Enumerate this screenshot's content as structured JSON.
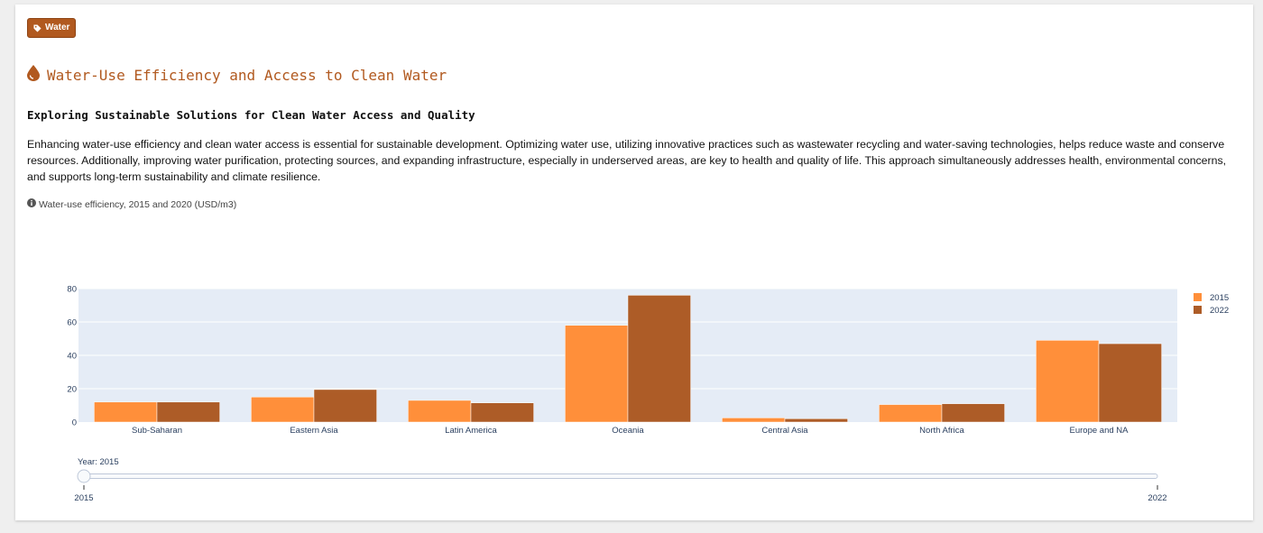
{
  "tag": {
    "label": "Water",
    "icon": "tag-icon"
  },
  "header": {
    "title": "Water-Use Efficiency and Access to Clean Water",
    "icon": "droplet-icon",
    "subtitle": "Exploring Sustainable Solutions for Clean Water Access and Quality"
  },
  "description": "Enhancing water-use efficiency and clean water access is essential for sustainable development. Optimizing water use, utilizing innovative practices such as wastewater recycling and water-saving technologies, helps reduce waste and conserve resources. Additionally, improving water purification, protecting sources, and expanding infrastructure, especially in underserved areas, are key to health and quality of life. This approach simultaneously addresses health, environmental concerns, and supports long-term sustainability and climate resilience.",
  "note": {
    "icon": "info-icon",
    "text": "Water-use efficiency, 2015 and 2020 (USD/m3)"
  },
  "colors": {
    "accent": "#b1591f",
    "series_2015": "#ff8f3a",
    "series_2022": "#ad5c27",
    "plot_bg": "#e5ecf6"
  },
  "chart_data": {
    "type": "bar",
    "categories": [
      "Sub-Saharan",
      "Eastern Asia",
      "Latin America",
      "Oceania",
      "Central Asia",
      "North Africa",
      "Europe and NA"
    ],
    "series": [
      {
        "name": "2015",
        "values": [
          12,
          15,
          13,
          58,
          2.5,
          10.5,
          49
        ]
      },
      {
        "name": "2022",
        "values": [
          12,
          19.5,
          11.5,
          76,
          2,
          11,
          47
        ]
      }
    ],
    "ylim": [
      0,
      80
    ],
    "yticks": [
      0,
      20,
      40,
      60,
      80
    ],
    "legend_placement": "top-right",
    "grid": true
  },
  "slider": {
    "label": "Year: 2015",
    "min_label": "2015",
    "max_label": "2022",
    "value_fraction": 0
  }
}
